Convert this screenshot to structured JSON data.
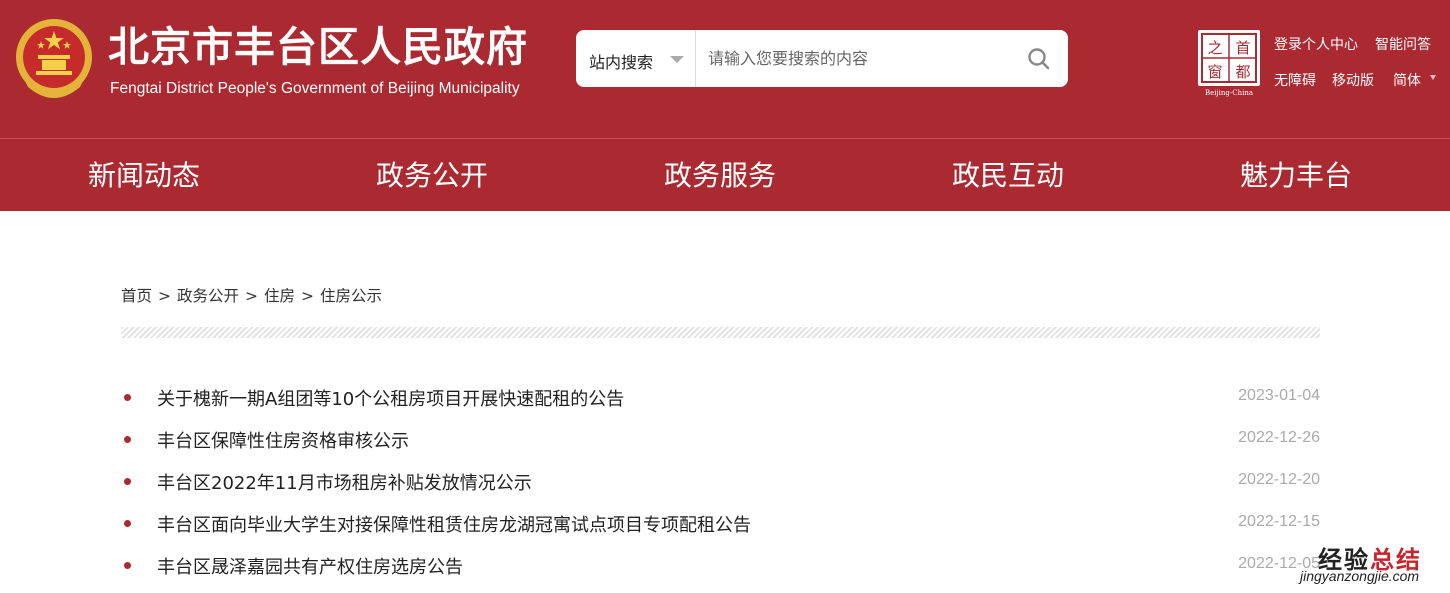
{
  "header": {
    "title": "北京市丰台区人民政府",
    "subtitle": "Fengtai District People's Government of Beijing Municipality",
    "capital_logo": "首都之窗 Beijing-China",
    "background_color": "#ab2a32"
  },
  "search": {
    "scope_label": "站内搜索",
    "placeholder": "请输入您要搜索的内容",
    "icon": "search-icon"
  },
  "top_links": {
    "login": "登录个人中心",
    "smart_qa": "智能问答",
    "accessibility": "无障碍",
    "mobile": "移动版",
    "language": "简体"
  },
  "nav": {
    "items": [
      {
        "label": "新闻动态"
      },
      {
        "label": "政务公开"
      },
      {
        "label": "政务服务"
      },
      {
        "label": "政民互动"
      },
      {
        "label": "魅力丰台"
      }
    ]
  },
  "breadcrumb": {
    "items": [
      "首页",
      "政务公开",
      "住房",
      "住房公示"
    ],
    "separator": ">"
  },
  "news": {
    "bullet_color": "#ab2a32",
    "items": [
      {
        "title": "关于槐新一期A组团等10个公租房项目开展快速配租的公告",
        "date": "2023-01-04"
      },
      {
        "title": "丰台区保障性住房资格审核公示",
        "date": "2022-12-26"
      },
      {
        "title": "丰台区2022年11月市场租房补贴发放情况公示",
        "date": "2022-12-20"
      },
      {
        "title": "丰台区面向毕业大学生对接保障性租赁住房龙湖冠寓试点项目专项配租公告",
        "date": "2022-12-15"
      },
      {
        "title": "丰台区晟泽嘉园共有产权住房选房公告",
        "date": "2022-12-05"
      }
    ]
  },
  "watermark": {
    "cn_part1": "经验",
    "cn_part2": "总结",
    "en": "jingyanzongjie.com"
  }
}
